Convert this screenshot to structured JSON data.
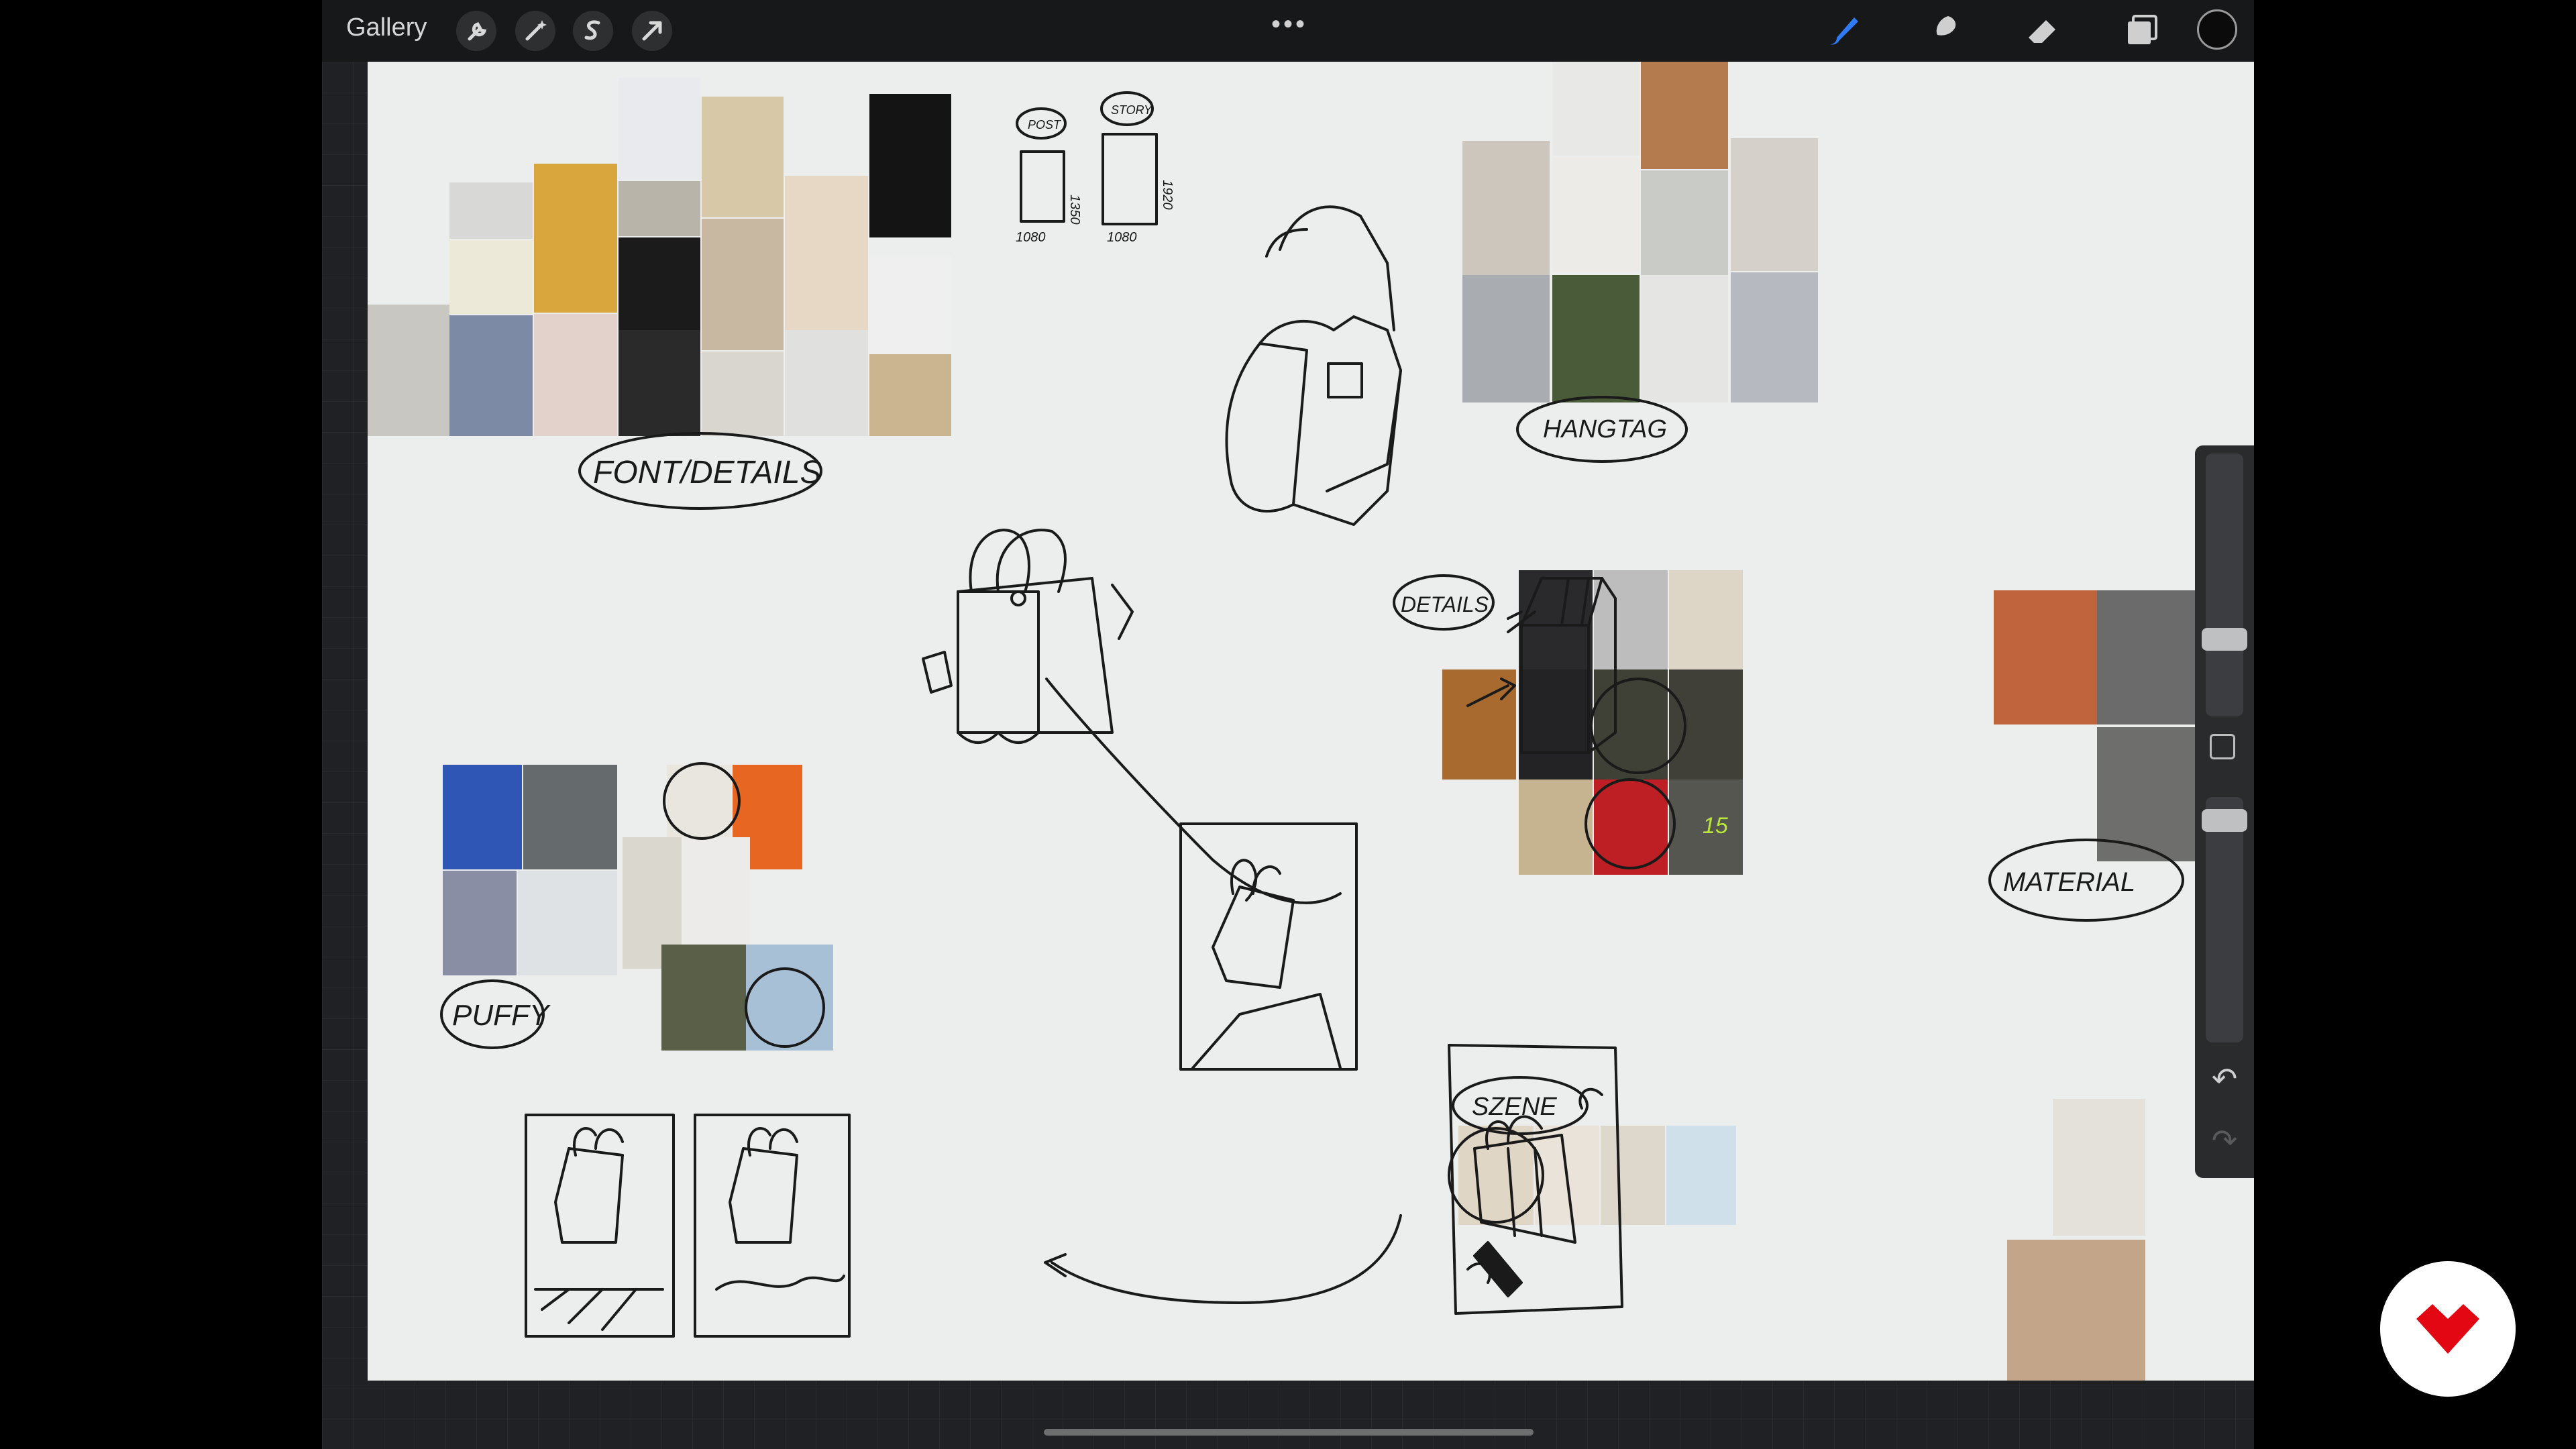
{
  "app": {
    "name": "Procreate"
  },
  "toolbar": {
    "gallery_label": "Gallery",
    "left_tools": [
      "wrench-icon",
      "magic-wand-icon",
      "selection-s-icon",
      "transform-arrow-icon"
    ],
    "more_label": "•••",
    "right_tools": [
      "brush-icon",
      "smudge-icon",
      "eraser-icon",
      "layers-icon"
    ],
    "active_tool": "brush",
    "accent": "#2f7bf5",
    "current_color": "#0b0b0b"
  },
  "canvas": {
    "labels": {
      "font_details": "FONT/DETAILS",
      "hangtag": "HANGTAG",
      "details": "DETAILS",
      "puffy": "PUFFY",
      "material": "MATERIAL",
      "szene": "SZENE",
      "post": "POST",
      "story": "STORY",
      "w1": "1080",
      "h1": "1350",
      "w2": "1080",
      "h2": "1920",
      "n15": "15"
    }
  },
  "sidebar": {
    "undo_icon": "↶",
    "redo_icon": "↷"
  },
  "overlay": {
    "logo": "brand-logo-icon",
    "logo_color": "#e30613"
  }
}
